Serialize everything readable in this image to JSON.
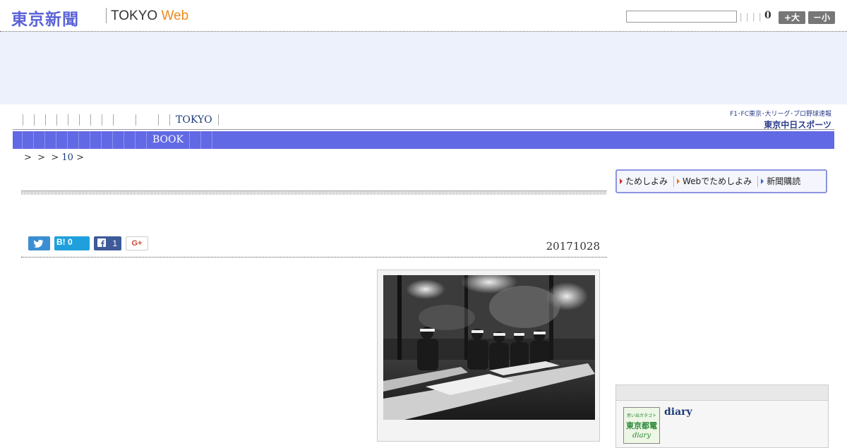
{
  "header": {
    "logo_jp": "東京新聞",
    "logo_en_prefix": "TOKYO",
    "logo_en_suffix": "Web",
    "font_size_value": "0",
    "enlarge_label": "+大",
    "shrink_label": "－小"
  },
  "topnav": {
    "label": "TOKYO"
  },
  "chunichi": {
    "line1": "F1･FC東京･大リーグ･プロ野球速報",
    "line2": "東京中日スポーツ"
  },
  "bluenav": {
    "label": "BOOK"
  },
  "breadcrumb": {
    "sep": ">",
    "link": "10"
  },
  "share": {
    "hatena_label": "B!",
    "hatena_count": "0",
    "facebook_count": "1",
    "gplus_label": "G+"
  },
  "article": {
    "date": "20171028"
  },
  "sidebar": {
    "read_buttons": [
      "ためしよみ",
      "Webでためしよみ",
      "新聞購読"
    ],
    "diary_thumb": {
      "t1": "思い出ガタゴト",
      "t2": "東京都電",
      "t3": "diary"
    },
    "diary_title": "diary"
  },
  "colors": {
    "brand": "#5a62d8",
    "nav_blue": "#6169e4",
    "web_orange": "#ee8a1c"
  }
}
